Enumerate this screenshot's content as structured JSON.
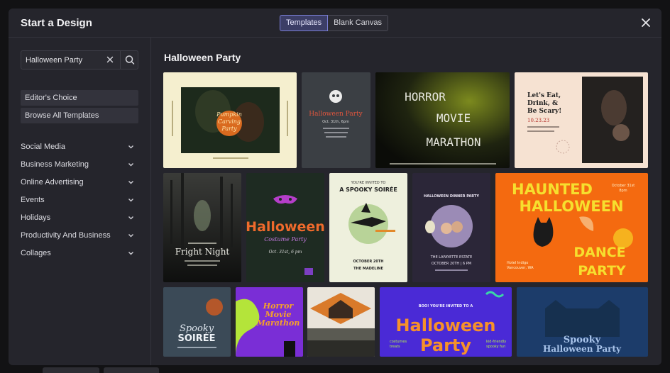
{
  "modal": {
    "title": "Start a Design",
    "toggle": {
      "templates": "Templates",
      "blank": "Blank Canvas"
    }
  },
  "search": {
    "value": "Halloween Party",
    "placeholder": ""
  },
  "sidebar": {
    "quick": [
      "Editor's Choice",
      "Browse All Templates"
    ],
    "categories": [
      "Social Media",
      "Business Marketing",
      "Online Advertising",
      "Events",
      "Holidays",
      "Productivity And Business",
      "Collages"
    ]
  },
  "main": {
    "heading": "Halloween Party",
    "templates": {
      "t1": {
        "lines": [
          "Pumpkin",
          "Carving",
          "Party"
        ]
      },
      "t2": {
        "lines": [
          "Halloween Party",
          "Oct. 31th, 6pm"
        ]
      },
      "t3": {
        "lines": [
          "HORROR",
          "MOVIE",
          "MARATHON"
        ]
      },
      "t4": {
        "lines": [
          "Let's Eat,",
          "Drink, &",
          "Be Scary!",
          "10.23.23"
        ]
      },
      "t5": {
        "lines": [
          "Fright Night"
        ]
      },
      "t6": {
        "lines": [
          "Halloween",
          "Costume Party",
          "Oct. 31st, 6 pm"
        ]
      },
      "t7": {
        "lines": [
          "YOU'RE INVITED TO",
          "A SPOOKY SOIRÉE",
          "OCTOBER 20TH",
          "THE MADELINE"
        ]
      },
      "t8": {
        "lines": [
          "HALLOWEEN DINNER PARTY",
          "THE LAFAYETTE ESTATE",
          "OCTOBER 20TH | 6 PM"
        ]
      },
      "t9": {
        "lines": [
          "HAUNTED",
          "HALLOWEEN",
          "DANCE",
          "PARTY",
          "October 31st",
          "8pm",
          "Hotel Indigo",
          "Vancouver, WA"
        ]
      },
      "t10": {
        "lines": [
          "Spooky",
          "SOIRÉE"
        ]
      },
      "t11": {
        "lines": [
          "Horror",
          "Movie",
          "Marathon"
        ]
      },
      "t13": {
        "lines": [
          "BOO! YOU'RE INVITED TO A",
          "Halloween",
          "Party",
          "costumes",
          "treats",
          "kid-friendly",
          "spooky fun"
        ]
      },
      "t14": {
        "lines": [
          "Spooky",
          "Halloween Party"
        ]
      }
    }
  },
  "colors": {
    "accent": "#7b7fd6",
    "modal_bg": "#25252c",
    "page_bg": "#121214"
  },
  "icons": [
    "close-icon",
    "clear-icon",
    "search-icon",
    "chevron-down-icon"
  ]
}
